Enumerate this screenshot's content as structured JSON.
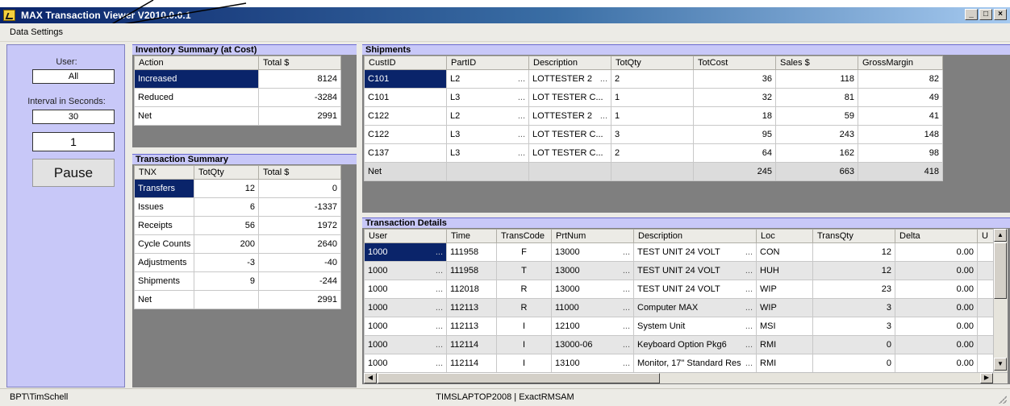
{
  "window": {
    "title": "MAX Transaction Viewer  V2010.0.0.1",
    "min_btn": "_",
    "max_btn": "□",
    "close_btn": "×"
  },
  "menu": {
    "data_settings": "Data Settings"
  },
  "controls": {
    "user_label": "User:",
    "user_value": "All",
    "interval_label": "Interval in Seconds:",
    "interval_value": "30",
    "counter": "1",
    "pause_label": "Pause"
  },
  "inventory_summary": {
    "title": "Inventory Summary (at Cost)",
    "columns": [
      "Action",
      "Total $"
    ],
    "rows": [
      {
        "action": "Increased",
        "total": "8124"
      },
      {
        "action": "Reduced",
        "total": "-3284"
      },
      {
        "action": "Net",
        "total": "2991"
      }
    ]
  },
  "transaction_summary": {
    "title": "Transaction Summary",
    "columns": [
      "TNX",
      "TotQty",
      "Total $"
    ],
    "rows": [
      {
        "tnx": "Transfers",
        "qty": "12",
        "total": "0"
      },
      {
        "tnx": "Issues",
        "qty": "6",
        "total": "-1337"
      },
      {
        "tnx": "Receipts",
        "qty": "56",
        "total": "1972"
      },
      {
        "tnx": "Cycle Counts",
        "qty": "200",
        "total": "2640"
      },
      {
        "tnx": "Adjustments",
        "qty": "-3",
        "total": "-40"
      },
      {
        "tnx": "Shipments",
        "qty": "9",
        "total": "-244"
      },
      {
        "tnx": "Net",
        "qty": "",
        "total": "2991"
      }
    ]
  },
  "shipments": {
    "title": "Shipments",
    "columns": [
      "CustID",
      "PartID",
      "Description",
      "TotQty",
      "TotCost",
      "Sales $",
      "GrossMargin"
    ],
    "rows": [
      {
        "cust": "C101",
        "part": "L2",
        "desc": "LOTTESTER 2",
        "qty": "2",
        "cost": "36",
        "sales": "118",
        "margin": "82"
      },
      {
        "cust": "C101",
        "part": "L3",
        "desc": "LOT TESTER C...",
        "qty": "1",
        "cost": "32",
        "sales": "81",
        "margin": "49"
      },
      {
        "cust": "C122",
        "part": "L2",
        "desc": "LOTTESTER 2",
        "qty": "1",
        "cost": "18",
        "sales": "59",
        "margin": "41"
      },
      {
        "cust": "C122",
        "part": "L3",
        "desc": "LOT TESTER C...",
        "qty": "3",
        "cost": "95",
        "sales": "243",
        "margin": "148"
      },
      {
        "cust": "C137",
        "part": "L3",
        "desc": "LOT TESTER C...",
        "qty": "2",
        "cost": "64",
        "sales": "162",
        "margin": "98"
      },
      {
        "cust": "Net",
        "part": "",
        "desc": "",
        "qty": "",
        "cost": "245",
        "sales": "663",
        "margin": "418"
      }
    ]
  },
  "transaction_details": {
    "title": "Transaction Details",
    "columns": [
      "User",
      "Time",
      "TransCode",
      "PrtNum",
      "Description",
      "Loc",
      "TransQty",
      "Delta",
      "U"
    ],
    "rows": [
      {
        "user": "1000",
        "time": "111958",
        "code": "F",
        "part": "13000",
        "desc": "TEST UNIT 24 VOLT",
        "loc": "CON",
        "qty": "12",
        "delta": "0.00"
      },
      {
        "user": "1000",
        "time": "111958",
        "code": "T",
        "part": "13000",
        "desc": "TEST UNIT 24 VOLT",
        "loc": "HUH",
        "qty": "12",
        "delta": "0.00"
      },
      {
        "user": "1000",
        "time": "112018",
        "code": "R",
        "part": "13000",
        "desc": "TEST UNIT 24 VOLT",
        "loc": "WIP",
        "qty": "23",
        "delta": "0.00"
      },
      {
        "user": "1000",
        "time": "112113",
        "code": "R",
        "part": "11000",
        "desc": "Computer MAX",
        "loc": "WIP",
        "qty": "3",
        "delta": "0.00"
      },
      {
        "user": "1000",
        "time": "112113",
        "code": "I",
        "part": "12100",
        "desc": "System Unit",
        "loc": "MSI",
        "qty": "3",
        "delta": "0.00"
      },
      {
        "user": "1000",
        "time": "112114",
        "code": "I",
        "part": "13000-06",
        "desc": "Keyboard Option Pkg6",
        "loc": "RMI",
        "qty": "0",
        "delta": "0.00"
      },
      {
        "user": "1000",
        "time": "112114",
        "code": "I",
        "part": "13100",
        "desc": "Monitor, 17\" Standard Res",
        "loc": "RMI",
        "qty": "0",
        "delta": "0.00"
      }
    ]
  },
  "status": {
    "left": "BPT\\TimSchell",
    "center": "TIMSLAPTOP2008 | ExactRMSAM"
  }
}
